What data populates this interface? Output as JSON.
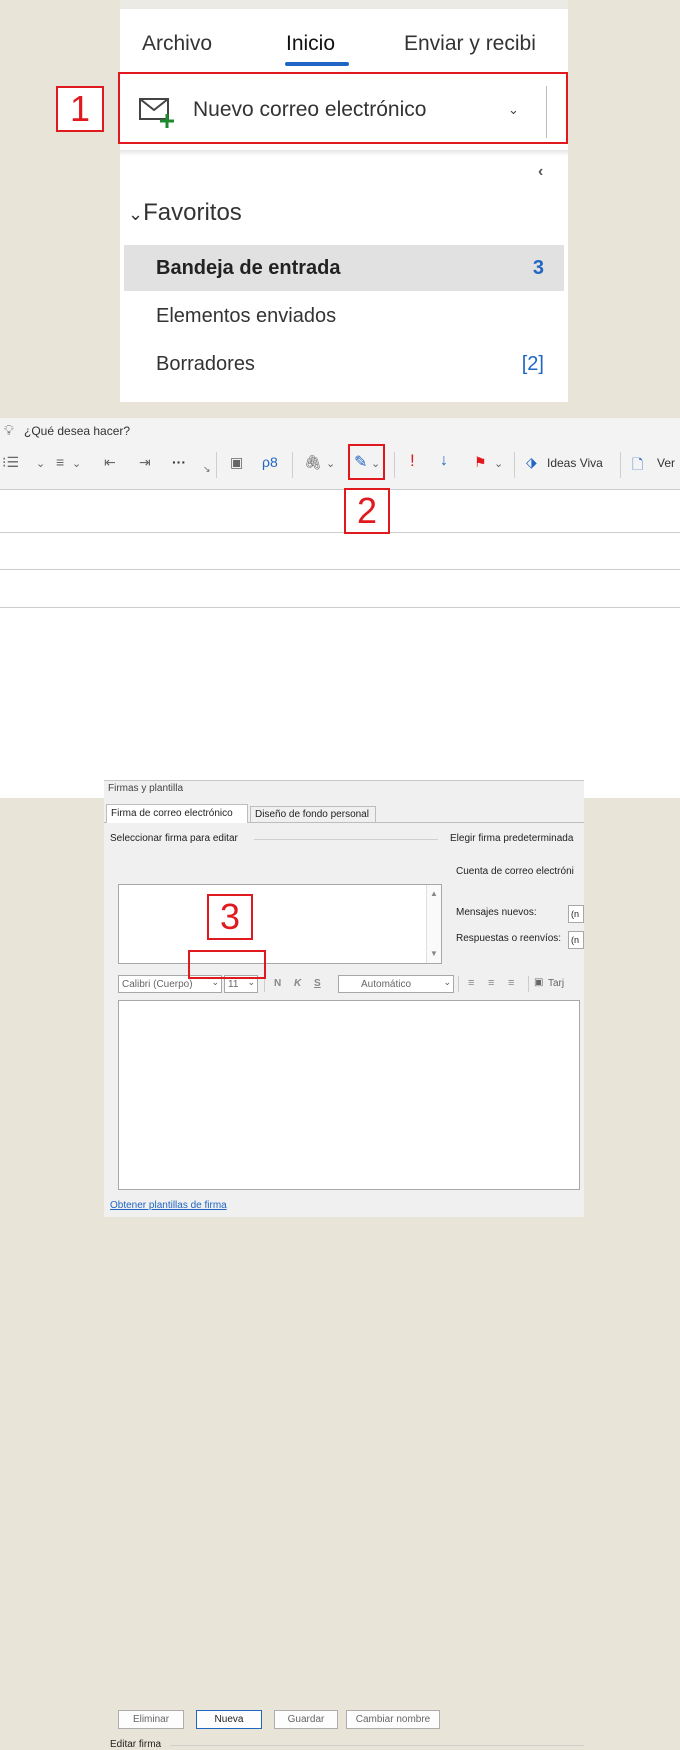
{
  "panel1": {
    "tabs": [
      "Archivo",
      "Inicio",
      "Enviar y recibi"
    ],
    "new_mail_label": "Nuevo correo electrónico",
    "new_mail_chevron": "⌄",
    "collapse_glyph": "‹",
    "favorites_chevron": "⌄",
    "favorites_label": "Favoritos",
    "folders": [
      {
        "label": "Bandeja de entrada",
        "count": "3",
        "selected": true
      },
      {
        "label": "Elementos enviados",
        "count": "",
        "selected": false
      },
      {
        "label": "Borradores",
        "count": "[2]",
        "selected": false
      }
    ]
  },
  "panel2": {
    "tell_me": "¿Qué desea hacer?",
    "tools": {
      "list": "⁝☰",
      "list_chev": "⌄",
      "align": "≡",
      "align_chev": "⌄",
      "outdent": "⇤",
      "indent": "⇥",
      "more": "···",
      "dialog": "↘",
      "address_book": "▣",
      "check_names": "ρ8",
      "attach": "🖇",
      "attach_chev": "⌄",
      "signature": "✎",
      "signature_chev": "⌄",
      "importance_high": "!",
      "importance_low": "↓",
      "flag": "⚑",
      "flag_chev": "⌄",
      "ideas_label": "Ideas Viva",
      "view_label": "Ver"
    }
  },
  "panel3": {
    "window_title": "Firmas y plantilla",
    "tab_email_signature": "Firma de correo electrónico",
    "tab_personal_stationery": "Diseño de fondo personal",
    "select_signature_label": "Seleccionar firma para editar",
    "choose_default_label": "Elegir firma predeterminada",
    "account_label": "Cuenta de correo electróni",
    "new_messages_label": "Mensajes nuevos:",
    "replies_label": "Respuestas o reenvíos:",
    "new_messages_value": "(n",
    "replies_value": "(n",
    "buttons": {
      "delete": "Eliminar",
      "new": "Nueva",
      "save": "Guardar",
      "rename": "Cambiar nombre"
    },
    "edit_signature_label": "Editar firma",
    "font_name": "Calibri (Cuerpo)",
    "font_size": "11",
    "bold": "N",
    "italic": "K",
    "underline": "S",
    "color_value": "Automático",
    "business_card": "Tarj",
    "get_templates_link": "Obtener plantillas de firma"
  },
  "markers": [
    "1",
    "2",
    "3"
  ],
  "colors": {
    "accent_blue": "#2266c4",
    "marker_red": "#e0191f",
    "background": "#e8e4d8",
    "importance_red": "#e0191f"
  }
}
